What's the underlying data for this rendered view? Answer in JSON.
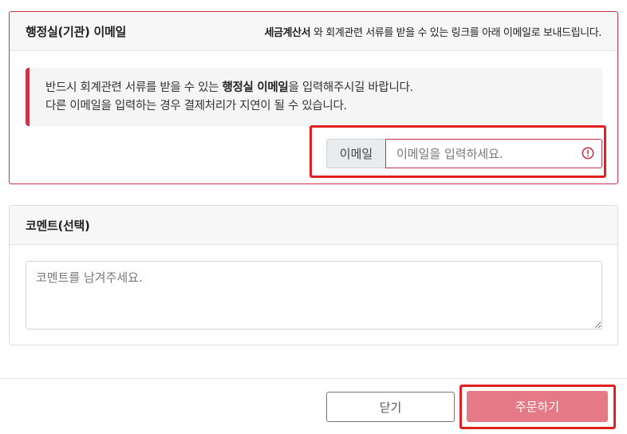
{
  "email_card": {
    "title": "행정실(기관) 이메일",
    "hint_bold": "세금계산서",
    "hint_rest": " 와 회계관련 서류를 받을 수 있는 링크를 아래 이메일로 보내드립니다.",
    "notice_line1_a": "반드시 회계관련 서류를 받을 수 있는 ",
    "notice_line1_bold": "행정실 이메일",
    "notice_line1_b": "을 입력해주시길 바랍니다.",
    "notice_line2": "다른 이메일을 입력하는 경우 결제처리가 지연이 될 수 있습니다.",
    "email_label": "이메일",
    "email_value": "",
    "email_placeholder": "이메일을 입력하세요.",
    "warning_icon": "exclamation-circle-icon"
  },
  "comment_card": {
    "title": "코멘트(선택)",
    "comment_value": "",
    "comment_placeholder": "코멘트를 남겨주세요."
  },
  "footer": {
    "close_label": "닫기",
    "order_label": "주문하기"
  },
  "colors": {
    "accent": "#c8354a",
    "highlight": "#e02121",
    "order_button": "#e57a86"
  }
}
